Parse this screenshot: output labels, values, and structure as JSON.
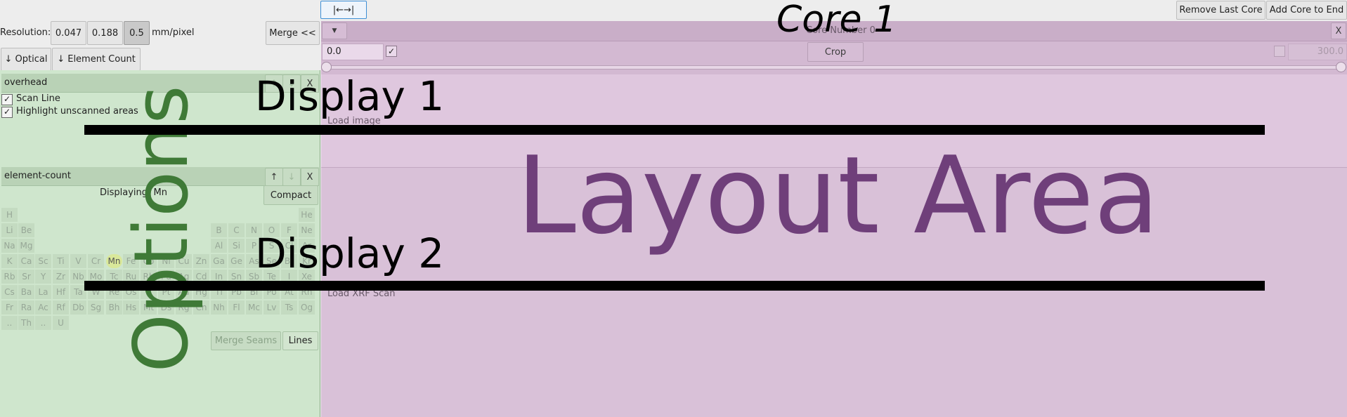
{
  "toolbar": {
    "collapse_label": "|←→|",
    "remove_last_core": "Remove Last Core",
    "add_core_to_end": "Add Core to End",
    "resolution_label": "Resolution:",
    "resolution_options": [
      "0.047",
      "0.188",
      "0.5"
    ],
    "resolution_selected": "0.5",
    "resolution_unit": "mm/pixel",
    "merge_label": "Merge <<",
    "optical_label": "↓ Optical",
    "element_count_label": "↓ Element Count"
  },
  "overhead": {
    "title": "overhead",
    "up": "↑",
    "down": "↓",
    "close": "X",
    "scan_line": "Scan Line",
    "highlight_unscanned": "Highlight unscanned areas",
    "scan_line_checked": true,
    "highlight_checked": true
  },
  "element_count": {
    "title": "element-count",
    "up": "↑",
    "down": "↓",
    "close": "X",
    "displaying": "Displaying: Mn",
    "compact": "Compact",
    "merge_seams": "Merge Seams",
    "lines": "Lines",
    "highlighted": "Mn",
    "table": [
      [
        "H",
        "",
        "",
        "",
        "",
        "",
        "",
        "",
        "",
        "",
        "",
        "",
        "",
        "",
        "",
        "",
        "",
        "He"
      ],
      [
        "Li",
        "Be",
        "",
        "",
        "",
        "",
        "",
        "",
        "",
        "",
        "",
        "",
        "B",
        "C",
        "N",
        "O",
        "F",
        "Ne"
      ],
      [
        "Na",
        "Mg",
        "",
        "",
        "",
        "",
        "",
        "",
        "",
        "",
        "",
        "",
        "Al",
        "Si",
        "P",
        "S",
        "Cl",
        "Ar"
      ],
      [
        "K",
        "Ca",
        "Sc",
        "Ti",
        "V",
        "Cr",
        "Mn",
        "Fe",
        "Co",
        "Ni",
        "Cu",
        "Zn",
        "Ga",
        "Ge",
        "As",
        "Se",
        "Br",
        "Kr"
      ],
      [
        "Rb",
        "Sr",
        "Y",
        "Zr",
        "Nb",
        "Mo",
        "Tc",
        "Ru",
        "Rh",
        "Pd",
        "Ag",
        "Cd",
        "In",
        "Sn",
        "Sb",
        "Te",
        "I",
        "Xe"
      ],
      [
        "Cs",
        "Ba",
        "La",
        "Hf",
        "Ta",
        "W",
        "Re",
        "Os",
        "Ir",
        "Pt",
        "Au",
        "Hg",
        "Tl",
        "Pb",
        "Bi",
        "Po",
        "At",
        "Rn"
      ],
      [
        "Fr",
        "Ra",
        "Ac",
        "Rf",
        "Db",
        "Sg",
        "Bh",
        "Hs",
        "Mt",
        "Ds",
        "Rg",
        "Cn",
        "Nh",
        "Fl",
        "Mc",
        "Lv",
        "Ts",
        "Og"
      ],
      [
        "..",
        "Th",
        "..",
        "U",
        "",
        "",
        "",
        "",
        "",
        "",
        "",
        "",
        "",
        "",
        "",
        "",
        "",
        ""
      ]
    ]
  },
  "core": {
    "heading": "Core 1",
    "number_label": "Core Number 0",
    "close": "X",
    "start_value": "0.0",
    "start_checked": true,
    "crop_label": "Crop",
    "end_value": "300.0",
    "end_checked": false,
    "load_image": "Load image",
    "load_xrf": "Load XRF Scan"
  },
  "overlays": {
    "options": "Options",
    "display1": "Display 1",
    "display2": "Display 2",
    "layout_area": "Layout Area"
  },
  "colors": {
    "options_green": "#3f7a37",
    "layout_purple": "#6f3f7a",
    "left_bg": "#cfe6cd",
    "right_bg": "#d9c1d8",
    "collapse_border": "#3d8fd6"
  }
}
